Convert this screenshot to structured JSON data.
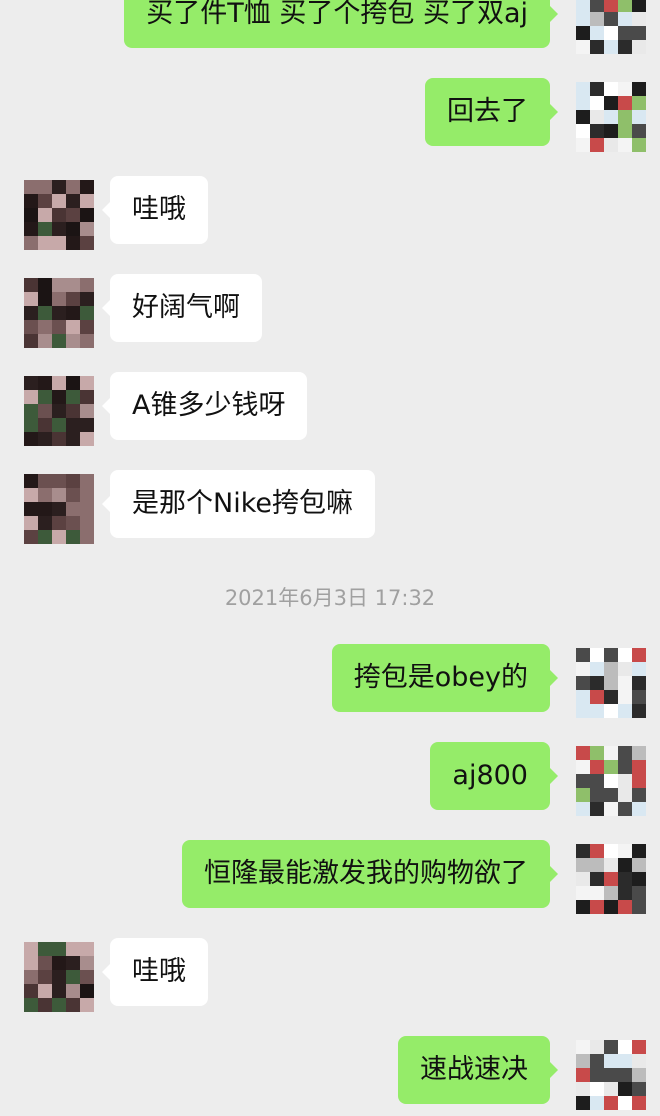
{
  "chat": {
    "timestamp": "2021年6月3日 17:32",
    "messages": [
      {
        "side": "out",
        "text": "买了件T恤 买了个挎包 买了双aj"
      },
      {
        "side": "out",
        "text": "回去了"
      },
      {
        "side": "in",
        "text": "哇哦"
      },
      {
        "side": "in",
        "text": "好阔气啊"
      },
      {
        "side": "in",
        "text": "A锥多少钱呀"
      },
      {
        "side": "in",
        "text": "是那个Nike挎包嘛"
      },
      {
        "side": "out",
        "text": "挎包是obey的"
      },
      {
        "side": "out",
        "text": "aj800"
      },
      {
        "side": "out",
        "text": "恒隆最能激发我的购物欲了"
      },
      {
        "side": "in",
        "text": "哇哦"
      },
      {
        "side": "out",
        "text": "速战速决"
      }
    ]
  }
}
